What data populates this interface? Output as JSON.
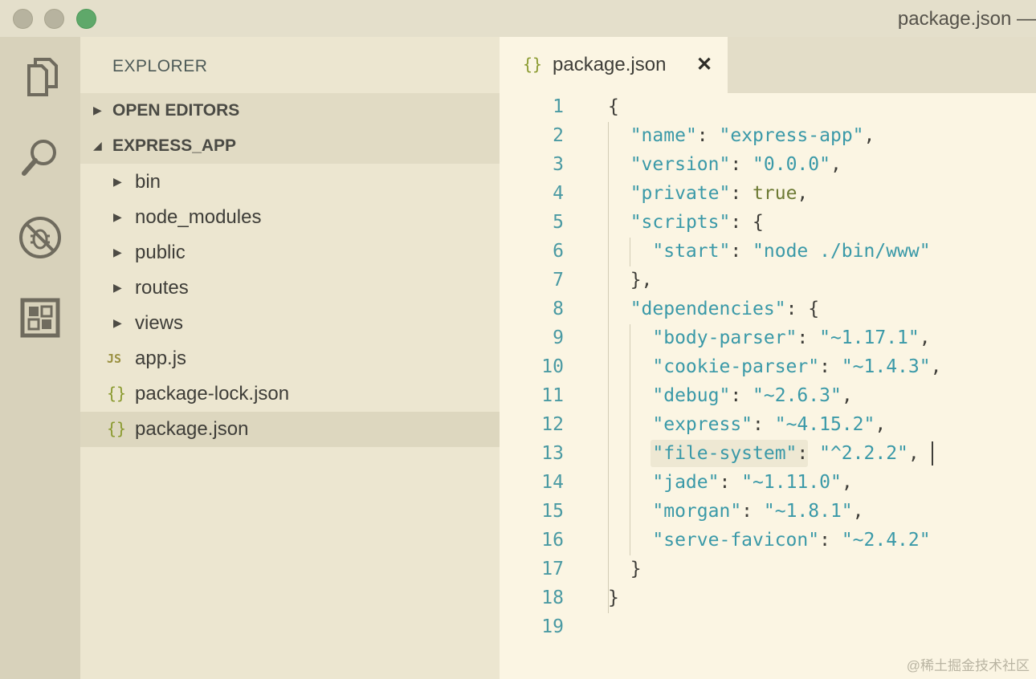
{
  "window": {
    "title": "package.json —"
  },
  "activity_bar": {
    "icons": [
      "explorer-icon",
      "search-icon",
      "debug-icon",
      "extensions-icon"
    ]
  },
  "sidebar": {
    "title": "EXPLORER",
    "sections": [
      {
        "label": "OPEN EDITORS",
        "expanded": false
      },
      {
        "label": "EXPRESS_APP",
        "expanded": true
      }
    ],
    "items": [
      {
        "label": "bin",
        "type": "folder",
        "icon": "▸"
      },
      {
        "label": "node_modules",
        "type": "folder",
        "icon": "▸"
      },
      {
        "label": "public",
        "type": "folder",
        "icon": "▸"
      },
      {
        "label": "routes",
        "type": "folder",
        "icon": "▸"
      },
      {
        "label": "views",
        "type": "folder",
        "icon": "▸"
      },
      {
        "label": "app.js",
        "type": "js",
        "icon": "JS"
      },
      {
        "label": "package-lock.json",
        "type": "json",
        "icon": "{}"
      },
      {
        "label": "package.json",
        "type": "json",
        "icon": "{}",
        "selected": true
      }
    ]
  },
  "editor": {
    "tab": {
      "icon": "{}",
      "label": "package.json",
      "close": "✕"
    },
    "lines": [
      {
        "n": "1",
        "code": "{"
      },
      {
        "n": "2",
        "code": "  \"name\": \"express-app\","
      },
      {
        "n": "3",
        "code": "  \"version\": \"0.0.0\","
      },
      {
        "n": "4",
        "code": "  \"private\": true,"
      },
      {
        "n": "5",
        "code": "  \"scripts\": {"
      },
      {
        "n": "6",
        "code": "    \"start\": \"node ./bin/www\""
      },
      {
        "n": "7",
        "code": "  },"
      },
      {
        "n": "8",
        "code": "  \"dependencies\": {"
      },
      {
        "n": "9",
        "code": "    \"body-parser\": \"~1.17.1\","
      },
      {
        "n": "10",
        "code": "    \"cookie-parser\": \"~1.4.3\","
      },
      {
        "n": "11",
        "code": "    \"debug\": \"~2.6.3\","
      },
      {
        "n": "12",
        "code": "    \"express\": \"~4.15.2\","
      },
      {
        "n": "13",
        "code": "    \"file-system\": \"^2.2.2\","
      },
      {
        "n": "14",
        "code": "    \"jade\": \"~1.11.0\","
      },
      {
        "n": "15",
        "code": "    \"morgan\": \"~1.8.1\","
      },
      {
        "n": "16",
        "code": "    \"serve-favicon\": \"~2.4.2\""
      },
      {
        "n": "17",
        "code": "  }"
      },
      {
        "n": "18",
        "code": "}"
      },
      {
        "n": "19",
        "code": ""
      }
    ]
  },
  "watermark": "@稀土掘金技术社区",
  "colors": {
    "accent": "#3a99a8",
    "background": "#fbf5e3",
    "sidebar": "#ece6d0",
    "activity": "#d8d2bb"
  }
}
